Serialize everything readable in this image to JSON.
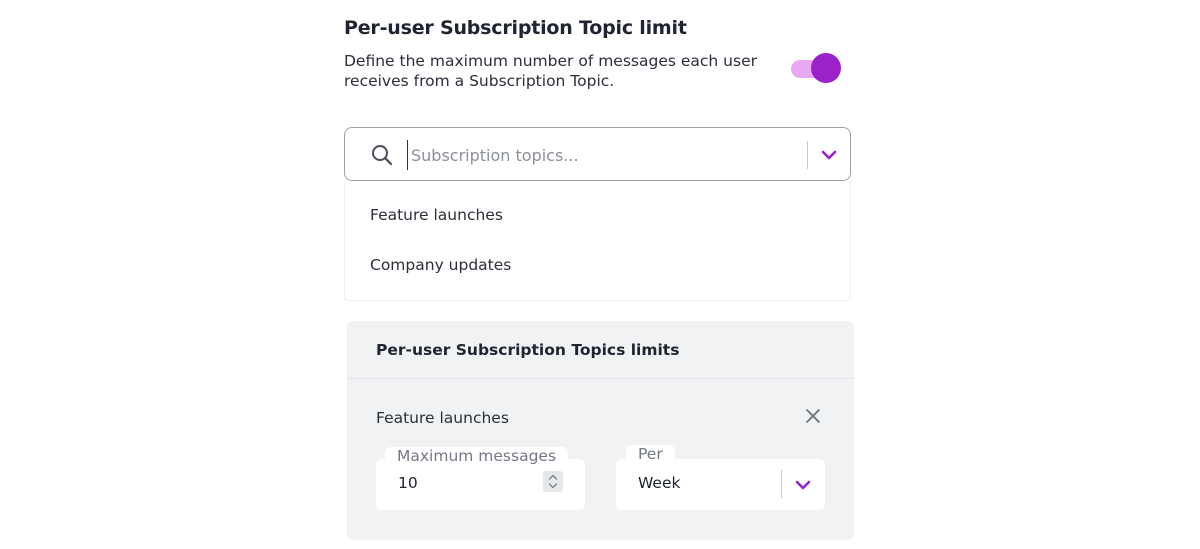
{
  "topic_limit": {
    "title": "Per-user Subscription Topic limit",
    "description": "Define the maximum number of messages each user receives from a Subscription Topic.",
    "toggle_on": true
  },
  "topic_search": {
    "placeholder": "Subscription topics...",
    "options": [
      {
        "label": "Feature launches"
      },
      {
        "label": "Company updates"
      }
    ]
  },
  "limits_panel": {
    "title": "Per-user Subscription Topics limits",
    "items": [
      {
        "topic": "Feature launches",
        "max_label": "Maximum messages",
        "max_value": "10",
        "per_label": "Per",
        "per_value": "Week"
      }
    ]
  },
  "colors": {
    "accent": "#9c21c9",
    "accent_light": "#e7a9f2",
    "panel_bg": "#f1f2f4"
  },
  "icons": [
    "search-icon",
    "chevron-down-icon",
    "close-icon",
    "stepper-icon"
  ]
}
